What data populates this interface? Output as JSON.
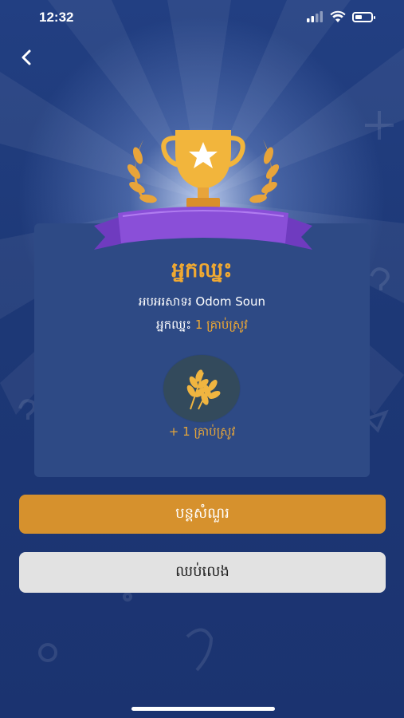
{
  "status_bar": {
    "time": "12:32"
  },
  "result": {
    "title": "អ្នកឈ្នះ",
    "opponent_line": "អបអរសាទរ Odom Soun",
    "winner_prefix": "អ្នកឈ្នះ",
    "winner_reward": "1 គ្រាប់ស្រូវ",
    "reward_label": "+ 1 គ្រាប់ស្រូវ"
  },
  "buttons": {
    "continue_label": "បន្តសំណួរ",
    "stop_label": "ឈប់លេង"
  },
  "colors": {
    "background": "#1d3572",
    "card": "#2e4a85",
    "accent": "#f0a932",
    "ribbon": "#8a4fd8",
    "continue_button": "#d6912d"
  },
  "icons": [
    "back-icon",
    "trophy-icon",
    "laurel-icon",
    "ribbon-icon",
    "wheat-icon",
    "wifi-icon",
    "battery-icon",
    "signal-icon"
  ]
}
